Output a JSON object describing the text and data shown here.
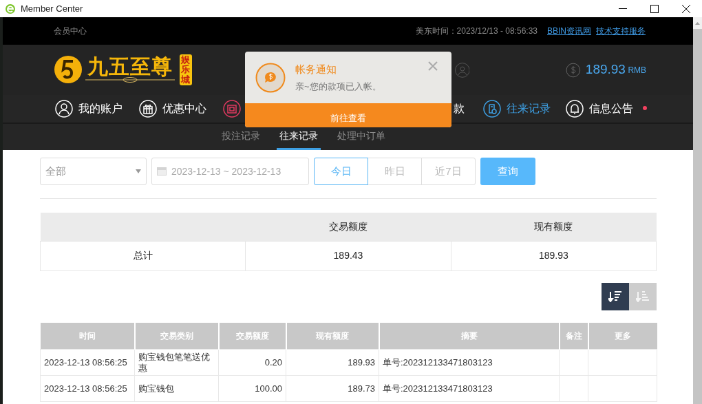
{
  "window": {
    "title": "Member Center"
  },
  "top_bar": {
    "title": "会员中心",
    "time": "美东时间：2023/12/13 - 08:56:33",
    "links": [
      "BBIN资讯网",
      "技术支持服务"
    ]
  },
  "header": {
    "logo": {
      "name": "九五至尊",
      "badge": "娱乐城"
    },
    "balance": "189.93",
    "currency": "RMB"
  },
  "nav": [
    {
      "label": "我的账户",
      "selected": false,
      "unread": false
    },
    {
      "label": "优惠中心",
      "selected": false,
      "unread": false
    },
    {
      "selected": false,
      "unread": false
    },
    {
      "label": "款",
      "selected": false,
      "unread": false
    },
    {
      "label": "往来记录",
      "selected": true,
      "unread": false
    },
    {
      "label": "信息公告",
      "selected": false,
      "unread": true
    }
  ],
  "subtabs": [
    {
      "label": "投注记录",
      "selected": false
    },
    {
      "label": "往来记录",
      "selected": true
    },
    {
      "label": "处理中订单",
      "selected": false
    }
  ],
  "filters": {
    "type": "全部",
    "date_range": "2023-12-13 ~ 2023-12-13",
    "ranges": [
      {
        "label": "今日",
        "selected": true
      },
      {
        "label": "昨日",
        "selected": false
      },
      {
        "label": "近7日",
        "selected": false
      }
    ],
    "query": "查询"
  },
  "summary": {
    "columns": [
      "交易额度",
      "现有额度"
    ],
    "row": [
      "总计",
      "189.43",
      "189.93"
    ]
  },
  "sort": [
    {
      "kind": "desc",
      "selected": true
    },
    {
      "kind": "asc",
      "selected": false
    }
  ],
  "table": {
    "columns": [
      "时间",
      "交易类别",
      "交易额度",
      "现有额度",
      "摘要",
      "备注",
      "更多"
    ],
    "rows": [
      [
        "2023-12-13 08:56:25",
        "购宝钱包笔笔送优惠",
        "0.20",
        "189.93",
        "单号:202312133471803123",
        "",
        ""
      ],
      [
        "2023-12-13 08:56:25",
        "购宝钱包",
        "100.00",
        "189.73",
        "单号:202312133471803123",
        "",
        ""
      ]
    ]
  },
  "notification": {
    "title": "帐务通知",
    "message": "亲~您的款项已入帐。",
    "action": "前往查看"
  }
}
